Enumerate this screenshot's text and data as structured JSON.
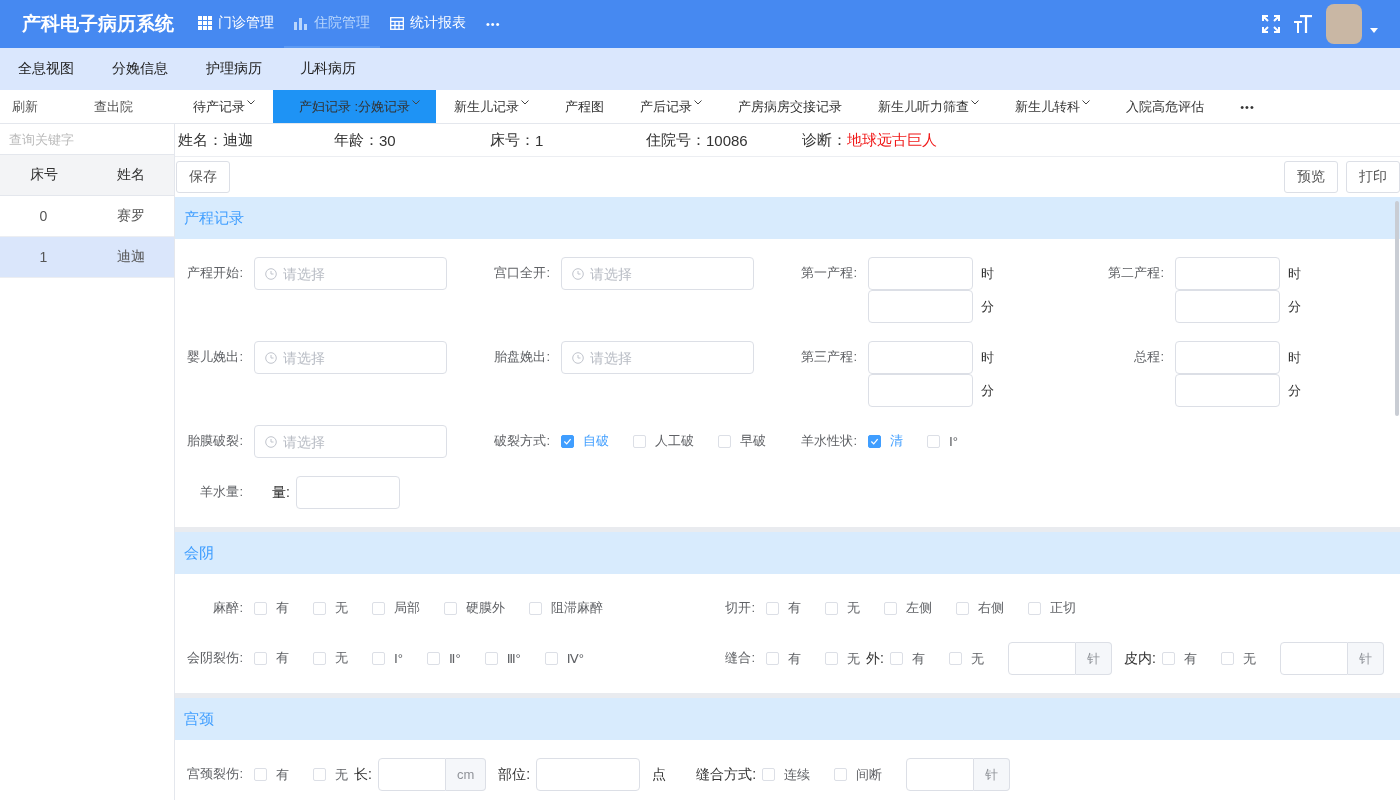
{
  "app": {
    "title": "产科电子病历系统"
  },
  "top_nav": [
    {
      "label": "门诊管理",
      "selected": false
    },
    {
      "label": "住院管理",
      "selected": true
    },
    {
      "label": "统计报表",
      "selected": false
    }
  ],
  "top_nav_more": "•••",
  "sub_nav": [
    "全息视图",
    "分娩信息",
    "护理病历",
    "儿科病历"
  ],
  "actions": [
    "刷新",
    "查出院"
  ],
  "tabs": [
    {
      "label": "待产记录",
      "has_menu": true,
      "selected": false
    },
    {
      "label": "产妇记录 :分娩记录",
      "has_menu": true,
      "selected": true
    },
    {
      "label": "新生儿记录",
      "has_menu": true,
      "selected": false
    },
    {
      "label": "产程图",
      "has_menu": false,
      "selected": false
    },
    {
      "label": "产后记录",
      "has_menu": true,
      "selected": false
    },
    {
      "label": "产房病房交接记录",
      "has_menu": false,
      "selected": false
    },
    {
      "label": "新生儿听力筛查",
      "has_menu": true,
      "selected": false
    },
    {
      "label": "新生儿转科",
      "has_menu": true,
      "selected": false
    },
    {
      "label": "入院高危评估",
      "has_menu": false,
      "selected": false
    }
  ],
  "tabs_more": "•••",
  "sidebar": {
    "search": {
      "placeholder": "查询关键字"
    },
    "columns": [
      "床号",
      "姓名"
    ],
    "rows": [
      {
        "bed": "0",
        "name": "赛罗",
        "selected": false
      },
      {
        "bed": "1",
        "name": "迪迦",
        "selected": true
      }
    ]
  },
  "patient": [
    {
      "label": "姓名：",
      "value": "迪迦",
      "alert": false
    },
    {
      "label": "年龄：",
      "value": "30",
      "alert": false
    },
    {
      "label": "床号：",
      "value": "1",
      "alert": false
    },
    {
      "label": "住院号：",
      "value": "10086",
      "alert": false
    },
    {
      "label": "诊断：",
      "value": "地球远古巨人",
      "alert": true
    }
  ],
  "buttons_left": [
    "保存"
  ],
  "buttons_right": [
    "预览",
    "打印"
  ],
  "sections": [
    {
      "title": "产程记录",
      "rows": [
        [
          {
            "kind": "time",
            "label": "产程开始:",
            "placeholder": "请选择"
          },
          {
            "kind": "time",
            "label": "宫口全开:",
            "placeholder": "请选择"
          },
          {
            "kind": "duration",
            "label": "第一产程:",
            "units": [
              "时",
              "分"
            ]
          },
          {
            "kind": "duration",
            "label": "第二产程:",
            "units": [
              "时",
              "分"
            ]
          }
        ],
        [
          {
            "kind": "time",
            "label": "婴儿娩出:",
            "placeholder": "请选择"
          },
          {
            "kind": "time",
            "label": "胎盘娩出:",
            "placeholder": "请选择"
          },
          {
            "kind": "duration",
            "label": "第三产程:",
            "units": [
              "时",
              "分"
            ]
          },
          {
            "kind": "duration",
            "label": "总程:",
            "units": [
              "时",
              "分"
            ]
          }
        ],
        [
          {
            "kind": "time",
            "label": "胎膜破裂:",
            "placeholder": "请选择"
          },
          {
            "kind": "group",
            "label": "破裂方式:",
            "parts": [
              {
                "kind": "check",
                "label": "自破",
                "checked": true
              },
              {
                "kind": "check",
                "label": "人工破",
                "checked": false
              },
              {
                "kind": "check",
                "label": "早破",
                "checked": false
              }
            ]
          },
          {
            "kind": "group",
            "label": "羊水性状:",
            "parts": [
              {
                "kind": "check",
                "label": "清",
                "checked": true
              },
              {
                "kind": "check",
                "label": "Ⅰ°",
                "checked": false
              }
            ]
          }
        ],
        [
          {
            "kind": "group",
            "label": "羊水量:",
            "parts": [
              {
                "kind": "text",
                "text": "量:"
              },
              {
                "kind": "input"
              }
            ]
          }
        ]
      ]
    },
    {
      "title": "会阴",
      "rows": [
        [
          {
            "kind": "group",
            "label": "麻醉:",
            "parts": [
              {
                "kind": "check",
                "label": "有",
                "checked": false
              },
              {
                "kind": "check",
                "label": "无",
                "checked": false
              },
              {
                "kind": "check",
                "label": "局部",
                "checked": false
              },
              {
                "kind": "check",
                "label": "硬膜外",
                "checked": false
              },
              {
                "kind": "check",
                "label": "阻滞麻醉",
                "checked": false
              }
            ]
          },
          {
            "kind": "group",
            "label": "切开:",
            "parts": [
              {
                "kind": "check",
                "label": "有",
                "checked": false
              },
              {
                "kind": "check",
                "label": "无",
                "checked": false
              },
              {
                "kind": "check",
                "label": "左侧",
                "checked": false
              },
              {
                "kind": "check",
                "label": "右侧",
                "checked": false
              },
              {
                "kind": "check",
                "label": "正切",
                "checked": false
              }
            ]
          }
        ],
        [
          {
            "kind": "group",
            "label": "会阴裂伤:",
            "parts": [
              {
                "kind": "check",
                "label": "有",
                "checked": false
              },
              {
                "kind": "check",
                "label": "无",
                "checked": false
              },
              {
                "kind": "check",
                "label": "Ⅰ°",
                "checked": false
              },
              {
                "kind": "check",
                "label": "Ⅱ°",
                "checked": false
              },
              {
                "kind": "check",
                "label": "Ⅲ°",
                "checked": false
              },
              {
                "kind": "check",
                "label": "Ⅳ°",
                "checked": false
              }
            ]
          },
          {
            "kind": "group",
            "label": "缝合:",
            "parts": [
              {
                "kind": "check",
                "label": "有",
                "checked": false
              },
              {
                "kind": "check",
                "label": "无",
                "checked": false
              },
              {
                "kind": "text",
                "text": "外:"
              },
              {
                "kind": "check",
                "label": "有",
                "checked": false
              },
              {
                "kind": "check",
                "label": "无",
                "checked": false
              },
              {
                "kind": "input",
                "addon": "针"
              },
              {
                "kind": "text",
                "text": "皮内:"
              },
              {
                "kind": "check",
                "label": "有",
                "checked": false
              },
              {
                "kind": "check",
                "label": "无",
                "checked": false
              },
              {
                "kind": "input",
                "addon": "针"
              }
            ]
          }
        ]
      ]
    },
    {
      "title": "宫颈",
      "rows": [
        [
          {
            "kind": "group",
            "label": "宫颈裂伤:",
            "parts": [
              {
                "kind": "check",
                "label": "有",
                "checked": false
              },
              {
                "kind": "check",
                "label": "无",
                "checked": false
              },
              {
                "kind": "text",
                "text": "长:"
              },
              {
                "kind": "input",
                "addon": "cm"
              },
              {
                "kind": "text",
                "text": "部位:"
              },
              {
                "kind": "input"
              },
              {
                "kind": "text",
                "text": "点"
              },
              {
                "kind": "text",
                "text": "缝合方式:"
              },
              {
                "kind": "check",
                "label": "连续",
                "checked": false
              },
              {
                "kind": "check",
                "label": "间断",
                "checked": false
              },
              {
                "kind": "input",
                "addon": "针"
              }
            ]
          }
        ]
      ]
    }
  ]
}
